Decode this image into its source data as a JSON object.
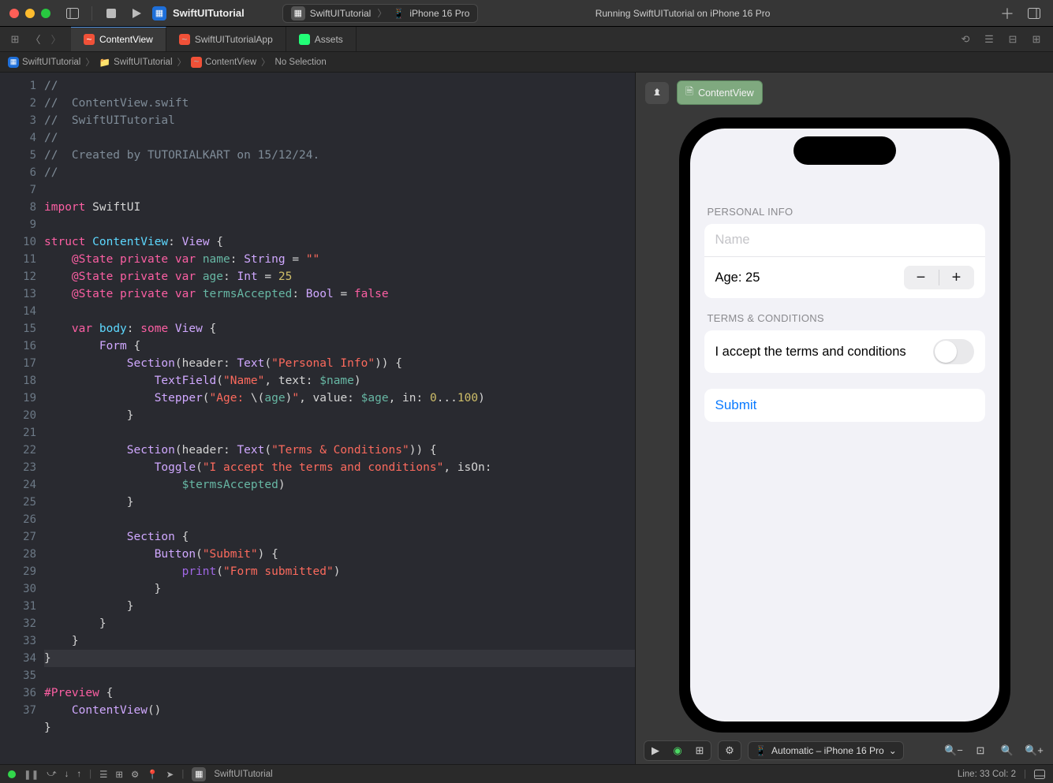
{
  "titlebar": {
    "project_name": "SwiftUITutorial",
    "scheme": "SwiftUITutorial",
    "destination": "iPhone 16 Pro",
    "run_status": "Running SwiftUITutorial on iPhone 16 Pro"
  },
  "tabs": {
    "items": [
      {
        "label": "ContentView",
        "icon": "swift",
        "active": true
      },
      {
        "label": "SwiftUITutorialApp",
        "icon": "swift",
        "active": false
      },
      {
        "label": "Assets",
        "icon": "assets",
        "active": false
      }
    ]
  },
  "breadcrumbs": {
    "items": [
      "SwiftUITutorial",
      "SwiftUITutorial",
      "ContentView",
      "No Selection"
    ]
  },
  "code": {
    "lines": [
      {
        "n": 1,
        "html": "<span class='tok-comment'>//</span>"
      },
      {
        "n": 2,
        "html": "<span class='tok-comment'>//  ContentView.swift</span>"
      },
      {
        "n": 3,
        "html": "<span class='tok-comment'>//  SwiftUITutorial</span>"
      },
      {
        "n": 4,
        "html": "<span class='tok-comment'>//</span>"
      },
      {
        "n": 5,
        "html": "<span class='tok-comment'>//  Created by TUTORIALKART on 15/12/24.</span>"
      },
      {
        "n": 6,
        "html": "<span class='tok-comment'>//</span>"
      },
      {
        "n": 7,
        "html": ""
      },
      {
        "n": 8,
        "html": "<span class='tok-kw'>import</span> <span class='tok-plain'>SwiftUI</span>"
      },
      {
        "n": 9,
        "html": ""
      },
      {
        "n": 10,
        "html": "<span class='tok-kw'>struct</span> <span class='tok-type'>ContentView</span>: <span class='tok-type2'>View</span> {"
      },
      {
        "n": 11,
        "html": "    <span class='tok-kw'>@State</span> <span class='tok-kw'>private</span> <span class='tok-kw'>var</span> <span class='tok-id'>name</span>: <span class='tok-type2'>String</span> = <span class='tok-str'>\"\"</span>"
      },
      {
        "n": 12,
        "html": "    <span class='tok-kw'>@State</span> <span class='tok-kw'>private</span> <span class='tok-kw'>var</span> <span class='tok-id'>age</span>: <span class='tok-type2'>Int</span> = <span class='tok-num'>25</span>"
      },
      {
        "n": 13,
        "html": "    <span class='tok-kw'>@State</span> <span class='tok-kw'>private</span> <span class='tok-kw'>var</span> <span class='tok-id'>termsAccepted</span>: <span class='tok-type2'>Bool</span> = <span class='tok-bool'>false</span>"
      },
      {
        "n": 14,
        "html": ""
      },
      {
        "n": 15,
        "html": "    <span class='tok-kw'>var</span> <span class='tok-type'>body</span>: <span class='tok-kw'>some</span> <span class='tok-type2'>View</span> {"
      },
      {
        "n": 16,
        "html": "        <span class='tok-type2'>Form</span> {"
      },
      {
        "n": 17,
        "html": "            <span class='tok-type2'>Section</span>(header: <span class='tok-type2'>Text</span>(<span class='tok-str'>\"Personal Info\"</span>)) {"
      },
      {
        "n": 18,
        "html": "                <span class='tok-type2'>TextField</span>(<span class='tok-str'>\"Name\"</span>, text: <span class='tok-id'>$name</span>)"
      },
      {
        "n": 19,
        "html": "                <span class='tok-type2'>Stepper</span>(<span class='tok-str'>\"Age: </span>\\(<span class='tok-id'>age</span>)<span class='tok-str'>\"</span>, value: <span class='tok-id'>$age</span>, in: <span class='tok-num'>0</span>...<span class='tok-num'>100</span>)"
      },
      {
        "n": 20,
        "html": "            }"
      },
      {
        "n": 21,
        "html": ""
      },
      {
        "n": 22,
        "html": "            <span class='tok-type2'>Section</span>(header: <span class='tok-type2'>Text</span>(<span class='tok-str'>\"Terms & Conditions\"</span>)) {"
      },
      {
        "n": 23,
        "html": "                <span class='tok-type2'>Toggle</span>(<span class='tok-str'>\"I accept the terms and conditions\"</span>, isOn: \n                    <span class='tok-id'>$termsAccepted</span>)"
      },
      {
        "n": 24,
        "html": "            }"
      },
      {
        "n": 25,
        "html": ""
      },
      {
        "n": 26,
        "html": "            <span class='tok-type2'>Section</span> {"
      },
      {
        "n": 27,
        "html": "                <span class='tok-type2'>Button</span>(<span class='tok-str'>\"Submit\"</span>) {"
      },
      {
        "n": 28,
        "html": "                    <span class='tok-func'>print</span>(<span class='tok-str'>\"Form submitted\"</span>)"
      },
      {
        "n": 29,
        "html": "                }"
      },
      {
        "n": 30,
        "html": "            }"
      },
      {
        "n": 31,
        "html": "        }"
      },
      {
        "n": 32,
        "html": "    }"
      },
      {
        "n": 33,
        "html": "}",
        "current": true
      },
      {
        "n": 34,
        "html": ""
      },
      {
        "n": 35,
        "html": "<span class='tok-kw'>#Preview</span> {"
      },
      {
        "n": 36,
        "html": "    <span class='tok-type2'>ContentView</span>()"
      },
      {
        "n": 37,
        "html": "}"
      }
    ]
  },
  "preview": {
    "badge_label": "ContentView",
    "section1_header": "PERSONAL INFO",
    "name_placeholder": "Name",
    "age_label": "Age: 25",
    "section2_header": "TERMS & CONDITIONS",
    "toggle_label": "I accept the terms and conditions",
    "submit_label": "Submit",
    "device_select": "Automatic – iPhone 16 Pro"
  },
  "statusbar": {
    "project": "SwiftUITutorial",
    "cursor": "Line: 33  Col: 2"
  }
}
